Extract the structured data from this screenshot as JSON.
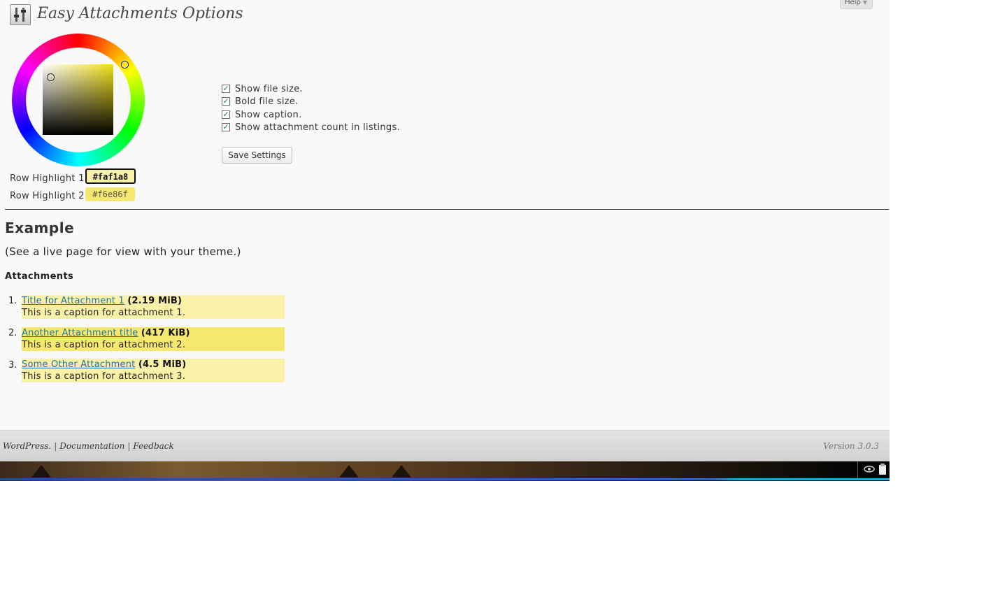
{
  "header": {
    "title": "Easy Attachments Options",
    "help_label": "Help",
    "help_arrow": "▼"
  },
  "color_picker": {
    "hue_color": "#f2e018",
    "highlight_1": {
      "label": "Row Highlight 1:",
      "value": "#faf1a8"
    },
    "highlight_2": {
      "label": "Row Highlight 2:",
      "value": "#f6e86f"
    }
  },
  "options": {
    "items": [
      {
        "label": "Show file size.",
        "checked": true
      },
      {
        "label": "Bold file size.",
        "checked": true
      },
      {
        "label": "Show caption.",
        "checked": true
      },
      {
        "label": "Show attachment count in listings.",
        "checked": true
      }
    ],
    "save_label": "Save Settings"
  },
  "example": {
    "title": "Example",
    "subtitle": "(See a live page for view with your theme.)",
    "attachments_heading": "Attachments",
    "attachments": [
      {
        "num": "1.",
        "title": "Title for Attachment 1",
        "size": "(2.19 MiB)",
        "caption": "This is a caption for attachment 1.",
        "bg": "#faf1a8"
      },
      {
        "num": "2.",
        "title": "Another Attachment title",
        "size": "(417 KiB)",
        "caption": "This is a caption for attachment 2.",
        "bg": "#f6e86f"
      },
      {
        "num": "3.",
        "title": "Some Other Attachment",
        "size": "(4.5 MiB)",
        "caption": "This is a caption for attachment 3.",
        "bg": "#faf1a8"
      }
    ]
  },
  "footer": {
    "wordpress": "WordPress.",
    "separator": "|",
    "documentation": "Documentation",
    "feedback": "Feedback",
    "version": "Version 3.0.3"
  }
}
